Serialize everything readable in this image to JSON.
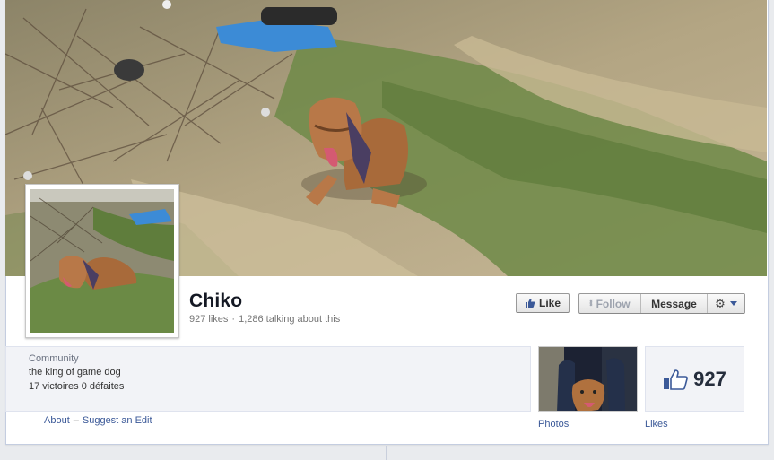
{
  "page": {
    "name": "Chiko",
    "likes_text": "927 likes",
    "talking_text": "1,286 talking about this",
    "separator": "·"
  },
  "actions": {
    "like_label": "Like",
    "follow_label": "Follow",
    "message_label": "Message",
    "settings_icon": "gear-icon",
    "dropdown_icon": "chevron-down-icon"
  },
  "about": {
    "category": "Community",
    "line1": "the king of game dog",
    "line2": "17 victoires 0 défaites",
    "about_link": "About",
    "link_separator": "–",
    "suggest_edit_link": "Suggest an Edit"
  },
  "apps": {
    "photos_label": "Photos",
    "likes_label": "Likes",
    "likes_count": "927"
  },
  "colors": {
    "link": "#3b5998",
    "background": "#e9ebee",
    "name": "#141823"
  }
}
